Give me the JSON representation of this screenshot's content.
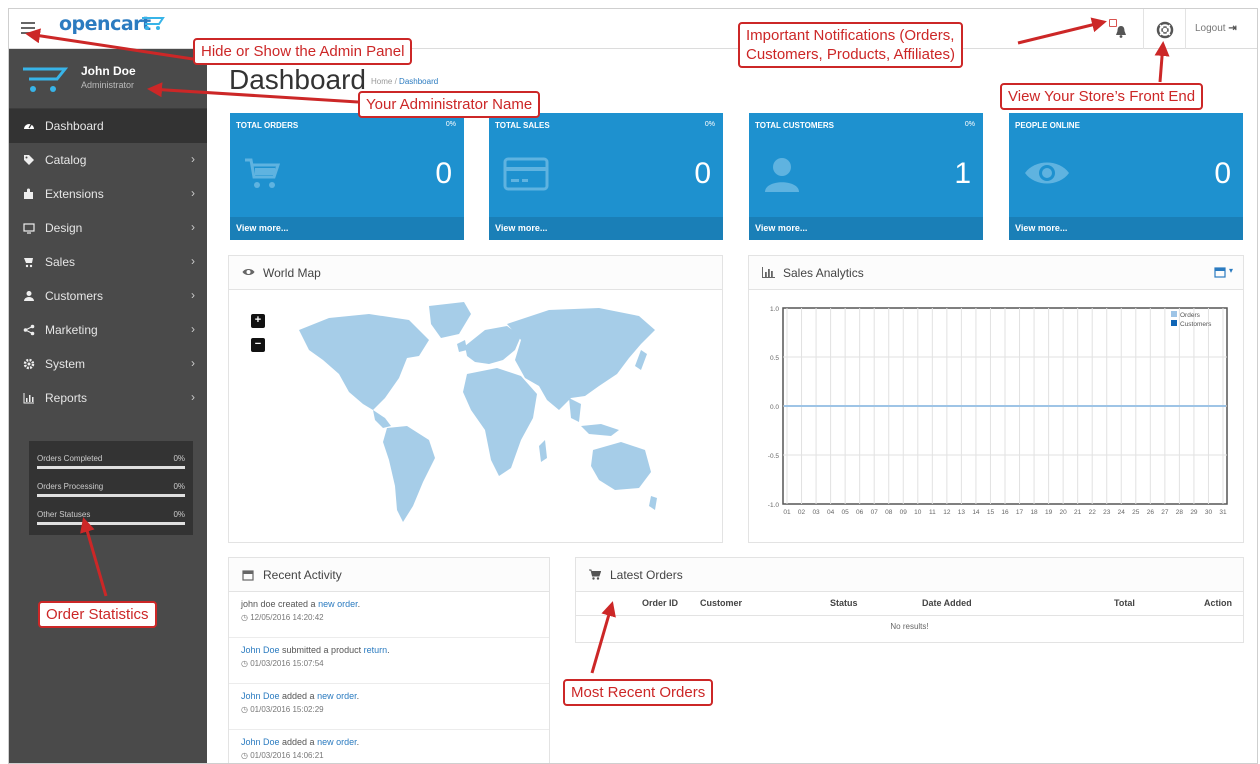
{
  "header": {
    "logo_text": "opencart",
    "logout_label": "Logout"
  },
  "sidebar": {
    "user_name": "John Doe",
    "user_role": "Administrator",
    "items": [
      {
        "label": "Dashboard",
        "icon": "dashboard-icon",
        "active": true
      },
      {
        "label": "Catalog",
        "icon": "tag-icon"
      },
      {
        "label": "Extensions",
        "icon": "puzzle-icon"
      },
      {
        "label": "Design",
        "icon": "monitor-icon"
      },
      {
        "label": "Sales",
        "icon": "cart-icon"
      },
      {
        "label": "Customers",
        "icon": "user-icon"
      },
      {
        "label": "Marketing",
        "icon": "share-icon"
      },
      {
        "label": "System",
        "icon": "gear-icon"
      },
      {
        "label": "Reports",
        "icon": "bar-chart-icon"
      }
    ],
    "stats": [
      {
        "label": "Orders Completed",
        "value": "0%"
      },
      {
        "label": "Orders Processing",
        "value": "0%"
      },
      {
        "label": "Other Statuses",
        "value": "0%"
      }
    ]
  },
  "main": {
    "title": "Dashboard",
    "breadcrumb_home": "Home",
    "breadcrumb_sep": "/",
    "breadcrumb_current": "Dashboard",
    "tiles": [
      {
        "title": "TOTAL ORDERS",
        "percent": "0%",
        "value": "0",
        "footer": "View more...",
        "icon": "cart-icon"
      },
      {
        "title": "TOTAL SALES",
        "percent": "0%",
        "value": "0",
        "footer": "View more...",
        "icon": "credit-card-icon"
      },
      {
        "title": "TOTAL CUSTOMERS",
        "percent": "0%",
        "value": "1",
        "footer": "View more...",
        "icon": "user-icon"
      },
      {
        "title": "PEOPLE ONLINE",
        "percent": "",
        "value": "0",
        "footer": "View more...",
        "icon": "eye-icon"
      }
    ],
    "world_map": {
      "title": "World Map",
      "zoom_in": "+",
      "zoom_out": "−"
    },
    "sales_analytics": {
      "title": "Sales Analytics",
      "y_ticks": [
        "1.0",
        "0.5",
        "0.0",
        "-0.5",
        "-1.0"
      ],
      "x_ticks": [
        "01",
        "02",
        "03",
        "04",
        "05",
        "06",
        "07",
        "08",
        "09",
        "10",
        "11",
        "12",
        "13",
        "14",
        "15",
        "16",
        "17",
        "18",
        "19",
        "20",
        "21",
        "22",
        "23",
        "24",
        "25",
        "26",
        "27",
        "28",
        "29",
        "30",
        "31"
      ],
      "legend": [
        {
          "name": "Orders",
          "color": "#9ec4e6"
        },
        {
          "name": "Customers",
          "color": "#1065b5"
        }
      ]
    },
    "recent_activity": {
      "title": "Recent Activity",
      "items": [
        {
          "pre": "john doe created a ",
          "link": "new order",
          "post": ".",
          "time": "12/05/2016 14:20:42"
        },
        {
          "pre": "",
          "link1": "John Doe",
          "mid": " submitted a product ",
          "link": "return",
          "post": ".",
          "time": "01/03/2016 15:07:54"
        },
        {
          "pre": "",
          "link1": "John Doe",
          "mid": " added a ",
          "link": "new order",
          "post": ".",
          "time": "01/03/2016 15:02:29"
        },
        {
          "pre": "",
          "link1": "John Doe",
          "mid": " added a ",
          "link": "new order",
          "post": ".",
          "time": "01/03/2016 14:06:21"
        }
      ]
    },
    "latest_orders": {
      "title": "Latest Orders",
      "columns": [
        "Order ID",
        "Customer",
        "Status",
        "Date Added",
        "Total",
        "Action"
      ],
      "empty_text": "No results!"
    }
  },
  "annotations": {
    "admin_panel": "Hide or Show the Admin Panel",
    "admin_name": "Your Administrator Name",
    "notifications_line1": "Important Notifications (Orders,",
    "notifications_line2": "Customers, Products, Affiliates)",
    "front_end": "View Your Store’s Front End",
    "order_stats": "Order Statistics",
    "recent_orders": "Most Recent Orders"
  },
  "colors": {
    "tile_blue": "#1e91cf",
    "tile_footer": "#1a7fb7",
    "sidebar": "#4a4a4a",
    "callout_red": "#cc2727",
    "map_land": "#a6cde8",
    "link": "#2b7bc0"
  }
}
